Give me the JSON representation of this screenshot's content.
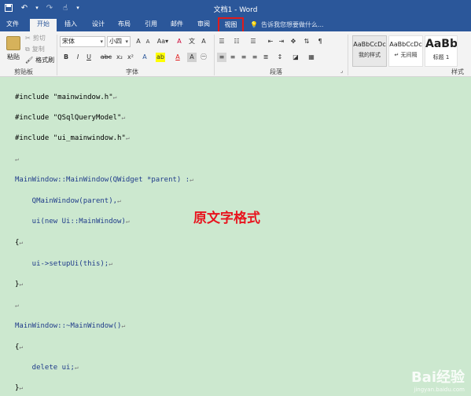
{
  "window": {
    "title": "文档1 - Word"
  },
  "qat": {
    "save_icon": "save-icon",
    "undo_icon": "undo-icon",
    "redo_icon": "redo-icon"
  },
  "tabs": [
    {
      "label": "文件"
    },
    {
      "label": "开始"
    },
    {
      "label": "插入"
    },
    {
      "label": "设计"
    },
    {
      "label": "布局"
    },
    {
      "label": "引用"
    },
    {
      "label": "邮件"
    },
    {
      "label": "审阅"
    },
    {
      "label": "视图"
    }
  ],
  "tellme": {
    "text": "告诉我您想要做什么..."
  },
  "ribbon": {
    "clipboard": {
      "paste": "粘贴",
      "cut": "剪切",
      "copy": "复制",
      "format_painter": "格式刷",
      "group": "剪贴板"
    },
    "font": {
      "name": "宋体",
      "size": "小四",
      "group": "字体"
    },
    "paragraph": {
      "group": "段落"
    },
    "styles": {
      "group": "样式",
      "items": [
        {
          "preview": "AaBbCcDc",
          "name": "我的样式"
        },
        {
          "preview": "AaBbCcDc",
          "name": "↵ 无间隔"
        },
        {
          "preview": "AaBb",
          "name": "标题 1"
        }
      ]
    }
  },
  "doc": {
    "lines": [
      "#include \"mainwindow.h\"",
      "#include \"QSqlQueryModel\"",
      "#include \"ui_mainwindow.h\"",
      "",
      "MainWindow::MainWindow(QWidget *parent) :",
      "    QMainWindow(parent),",
      "    ui(new Ui::MainWindow)",
      "{",
      "    ui->setupUi(this);",
      "}",
      "",
      "MainWindow::~MainWindow()",
      "{",
      "    delete ui;",
      "}"
    ],
    "para_mark": "↵",
    "note": "原文字格式"
  },
  "watermark": {
    "brand": "Bai经验",
    "url": "jingyan.baidu.com"
  }
}
